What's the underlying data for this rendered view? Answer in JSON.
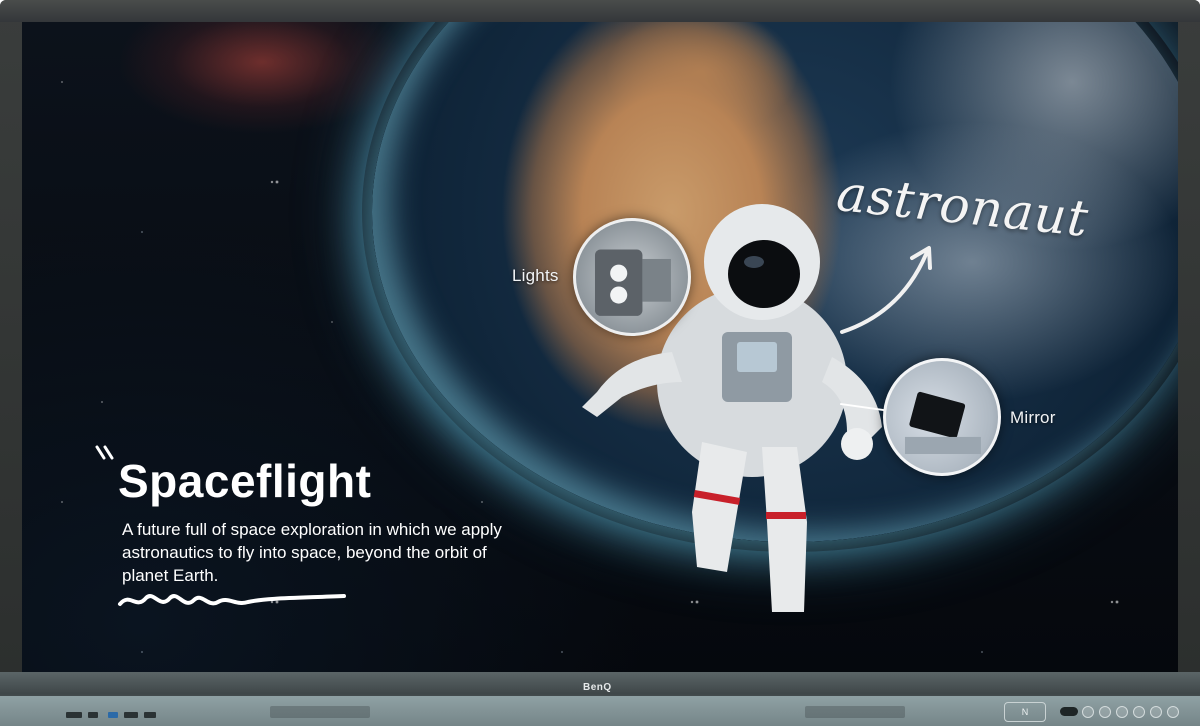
{
  "slide": {
    "title": "Spaceflight",
    "description": "A future full of space exploration in which we apply astronautics to fly into space, beyond the orbit of planet Earth.",
    "handwritten_label": "astronaut",
    "callouts": [
      {
        "label": "Lights"
      },
      {
        "label": "Mirror"
      }
    ]
  },
  "device": {
    "brand": "BenQ",
    "nfc_label": "N"
  },
  "colors": {
    "bezel": "#3a3d3c",
    "bottom_strip": "#8fa1a4",
    "text": "#ffffff",
    "earth_glow": "#6ec8e6",
    "suit_stripe": "#c8202a"
  },
  "icons": [
    "nfc-icon",
    "power-icon",
    "usb-port-icon",
    "hdmi-port-icon"
  ]
}
